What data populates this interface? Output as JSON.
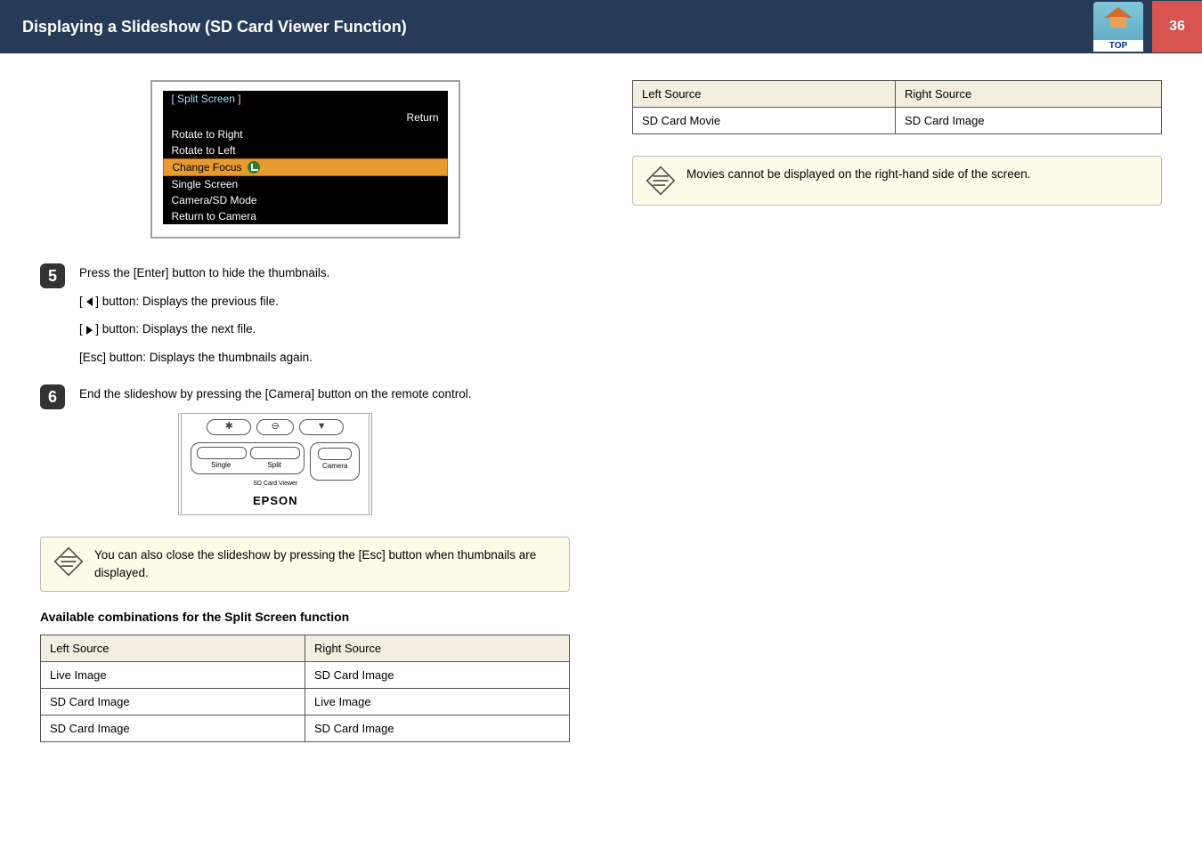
{
  "header": {
    "title": "Displaying a Slideshow (SD Card Viewer Function)",
    "top_label": "TOP",
    "page_number": "36"
  },
  "menu_fig": {
    "title": "[ Split Screen ]",
    "return": "Return",
    "items": [
      "Rotate to Right",
      "Rotate to Left",
      "Change Focus",
      "Single Screen",
      "Camera/SD Mode",
      "Return to Camera"
    ]
  },
  "steps": {
    "s5": {
      "num": "5",
      "line1": "Press the [Enter] button to hide the thumbnails.",
      "bullets": [
        "] button: Displays the previous file.",
        "] button: Displays the next file.",
        "[Esc] button: Displays the thumbnails again."
      ],
      "bullet_prefix_open": "["
    },
    "s6": {
      "num": "6",
      "text": "End the slideshow by pressing the [Camera] button on the remote control."
    }
  },
  "remote": {
    "single": "Single",
    "split": "Split",
    "camera": "Camera",
    "sd_label": "SD Card Viewer",
    "brand": "EPSON"
  },
  "note_left": "You can also close the slideshow by pressing the [Esc] button when thumbnails are displayed.",
  "subhead": "Available combinations for the Split Screen function",
  "table_left": {
    "head": [
      "Left Source",
      "Right Source"
    ],
    "rows": [
      [
        "Live Image",
        "SD Card Image"
      ],
      [
        "SD Card Image",
        "Live Image"
      ],
      [
        "SD Card Image",
        "SD Card Image"
      ]
    ]
  },
  "table_right": {
    "head": [
      "Left Source",
      "Right Source"
    ],
    "rows": [
      [
        "SD Card Movie",
        "SD Card Image"
      ]
    ]
  },
  "note_right": "Movies cannot be displayed on the right-hand side of the screen."
}
